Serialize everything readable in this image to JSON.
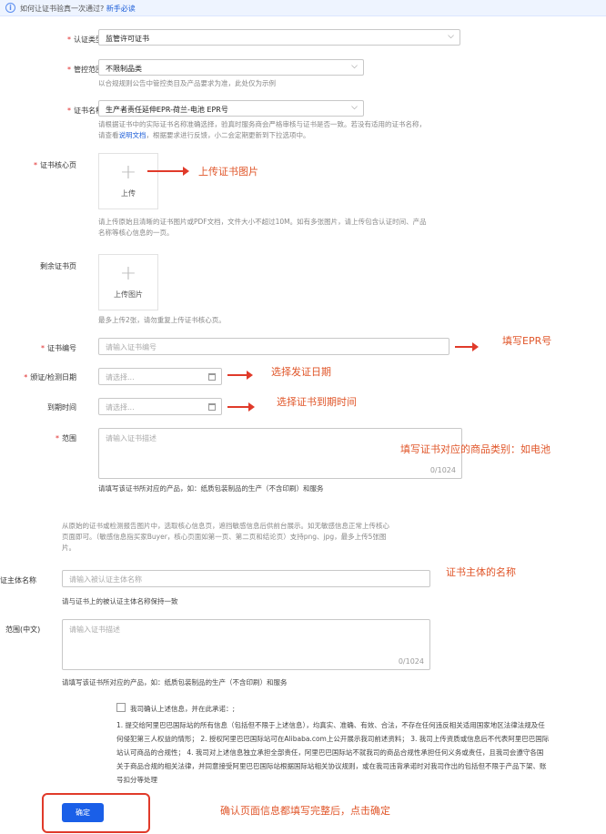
{
  "banner": {
    "text": "如何让证书验真一次通过?",
    "link": "新手必读"
  },
  "fields": {
    "cert_type": {
      "label": "认证类型",
      "value": "监管许可证书"
    },
    "scope_control": {
      "label": "管控范围",
      "value": "不限制品类",
      "hint": "以合规规则公告中管控类目及产品要求为准，此处仅为示例"
    },
    "cert_name": {
      "label": "证书名称",
      "value": "生产者责任延伸EPR-荷兰-电池 EPR号",
      "hint1": "请根据证书中的实际证书名称准确选择，验真时服务商会严格审核与证书是否一致。若没有适用的证书名称，",
      "hint2_pre": "请查看",
      "hint2_link": "说明文档",
      "hint2_post": "，根据要求进行反馈，小二会定期更新到下拉选项中。"
    },
    "cert_core": {
      "label": "证书核心页",
      "upload": "上传",
      "hint1": "请上传原始且清晰的证书图片或PDF文档，文件大小不超过10M。如有多张图片，请上传包含认证时间、产品",
      "hint2": "名称等核心信息的一页。"
    },
    "cert_rest": {
      "label": "剩余证书页",
      "upload": "上传图片",
      "hint": "最多上传2张，请勿重复上传证书核心页。"
    },
    "cert_no": {
      "label": "证书编号",
      "placeholder": "请输入证书编号"
    },
    "issue_date": {
      "label": "颁证/检测日期",
      "placeholder": "请选择..."
    },
    "expire_date": {
      "label": "到期时间",
      "placeholder": "请选择..."
    },
    "scope": {
      "label": "范围",
      "placeholder": "请输入证书描述",
      "count": "0/1024",
      "hint": "请填写该证书所对应的产品，如：纸质包装制品的生产（不含印刷）和服务"
    },
    "extract_hint": {
      "l1": "从原始的证书或检测报告图片中，选取核心信息页，遮挡敏感信息后供前台展示。如无敏感信息正常上传核心",
      "l2": "页面即可。（敏感信息指买家Buyer，核心页面如第一页、第二页和结论页）支持png、jpg，最多上传5张图",
      "l3": "片。"
    },
    "subject": {
      "label": "认证主体名称",
      "placeholder": "请输入被认证主体名称",
      "hint": "请与证书上的被认证主体名称保持一致"
    },
    "scope_cn": {
      "label": "范围(中文)",
      "placeholder": "请输入证书描述",
      "count": "0/1024",
      "hint": "请填写该证书所对应的产品，如：纸质包装制品的生产（不含印刷）和服务"
    }
  },
  "agreement": {
    "checkbox_label": "我司确认上述信息，并在此承诺：;",
    "l1": "1. 提交给阿里巴巴国际站的所有信息（包括但不限于上述信息），均真实、准确、有效、合法，不存在任何违反相关适用国家地区法律法规及任",
    "l2": "何侵犯第三人权益的情形；  2. 授权阿里巴巴国际站可在Alibaba.com上公开展示我司前述资料；  3. 我司上传资质或信息后不代表阿里巴巴国际",
    "l3": "站认可商品的合规性；  4. 我司对上述信息独立承担全部责任，阿里巴巴国际站不就我司的商品合规性承担任何义务或责任，且我司会遵守各国",
    "l4": "关于商品合规的相关法律，并同意接受阿里巴巴国际站根据国际站相关协议规则，或在我司违背承诺时对我司作出的包括但不限于产品下架、账",
    "l5": "号扣分等处理"
  },
  "confirm_button": "确定",
  "annotations": {
    "upload": "上传证书图片",
    "epr": "填写EPR号",
    "issue": "选择发证日期",
    "expire": "选择证书到期时间",
    "category": "填写证书对应的商品类别：如电池",
    "subject": "证书主体的名称",
    "confirm": "确认页面信息都填写完整后，点击确定"
  },
  "colors": {
    "primary": "#1a5fe8",
    "annotation": "#e0562a",
    "required": "#e02a2a"
  }
}
